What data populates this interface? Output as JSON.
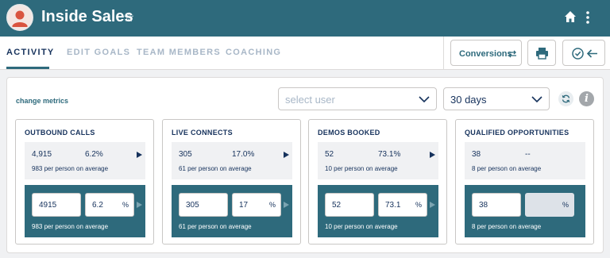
{
  "header": {
    "title": "Inside Sales"
  },
  "tabs": [
    {
      "label": "ACTIVITY",
      "active": true
    },
    {
      "label": "EDIT GOALS",
      "active": false
    },
    {
      "label": "TEAM MEMBERS",
      "active": false
    },
    {
      "label": "COACHING",
      "active": false
    }
  ],
  "toolbar": {
    "conversions_label": "Conversions"
  },
  "controls": {
    "change_metrics": "change metrics",
    "user_select": {
      "value": "",
      "placeholder": "select user"
    },
    "period_select": {
      "value": "30 days"
    }
  },
  "colors": {
    "primary": "#2e6a7c",
    "text": "#16325c",
    "muted": "#a8b7c7"
  },
  "metrics": [
    {
      "title": "OUTBOUND CALLS",
      "value": "4,915",
      "percent": "6.2%",
      "per_person": "983 per person on average",
      "goal_value": "4915",
      "goal_percent": "6.2",
      "percent_suffix": "%",
      "goal_per_person": "983 per person on average"
    },
    {
      "title": "LIVE CONNECTS",
      "value": "305",
      "percent": "17.0%",
      "per_person": "61 per person on average",
      "goal_value": "305",
      "goal_percent": "17",
      "percent_suffix": "%",
      "goal_per_person": "61 per person on average"
    },
    {
      "title": "DEMOS BOOKED",
      "value": "52",
      "percent": "73.1%",
      "per_person": "10 per person on average",
      "goal_value": "52",
      "goal_percent": "73.1",
      "percent_suffix": "%",
      "goal_per_person": "10 per person on average"
    },
    {
      "title": "QUALIFIED OPPORTUNITIES",
      "value": "38",
      "percent": "--",
      "per_person": "8 per person on average",
      "goal_value": "38",
      "goal_percent": "",
      "percent_suffix": "%",
      "goal_per_person": "8 per person on average"
    }
  ]
}
